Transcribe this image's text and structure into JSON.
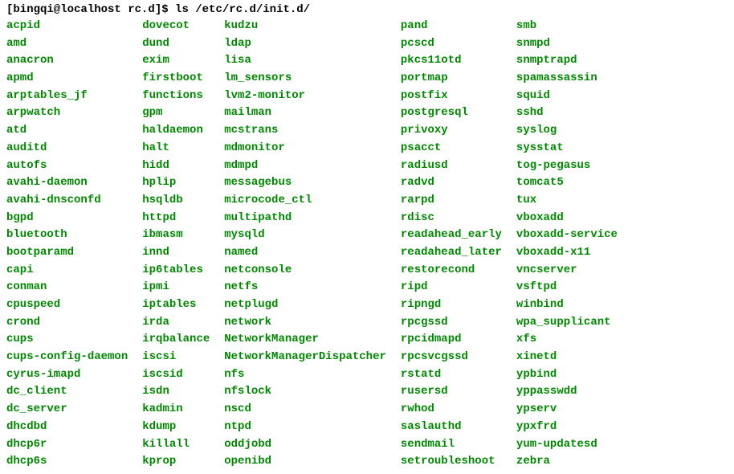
{
  "prompt": "[bingqi@localhost rc.d]$ ",
  "command": "ls /etc/rc.d/init.d/",
  "columns": [
    [
      "acpid",
      "amd",
      "anacron",
      "apmd",
      "arptables_jf",
      "arpwatch",
      "atd",
      "auditd",
      "autofs",
      "avahi-daemon",
      "avahi-dnsconfd",
      "bgpd",
      "bluetooth",
      "bootparamd",
      "capi",
      "conman",
      "cpuspeed",
      "crond",
      "cups",
      "cups-config-daemon",
      "cyrus-imapd",
      "dc_client",
      "dc_server",
      "dhcdbd",
      "dhcp6r",
      "dhcp6s"
    ],
    [
      "dovecot",
      "dund",
      "exim",
      "firstboot",
      "functions",
      "gpm",
      "haldaemon",
      "halt",
      "hidd",
      "hplip",
      "hsqldb",
      "httpd",
      "ibmasm",
      "innd",
      "ip6tables",
      "ipmi",
      "iptables",
      "irda",
      "irqbalance",
      "iscsi",
      "iscsid",
      "isdn",
      "kadmin",
      "kdump",
      "killall",
      "kprop"
    ],
    [
      "kudzu",
      "ldap",
      "lisa",
      "lm_sensors",
      "lvm2-monitor",
      "mailman",
      "mcstrans",
      "mdmonitor",
      "mdmpd",
      "messagebus",
      "microcode_ctl",
      "multipathd",
      "mysqld",
      "named",
      "netconsole",
      "netfs",
      "netplugd",
      "network",
      "NetworkManager",
      "NetworkManagerDispatcher",
      "nfs",
      "nfslock",
      "nscd",
      "ntpd",
      "oddjobd",
      "openibd"
    ],
    [
      "pand",
      "pcscd",
      "pkcs11otd",
      "portmap",
      "postfix",
      "postgresql",
      "privoxy",
      "psacct",
      "radiusd",
      "radvd",
      "rarpd",
      "rdisc",
      "readahead_early",
      "readahead_later",
      "restorecond",
      "ripd",
      "ripngd",
      "rpcgssd",
      "rpcidmapd",
      "rpcsvcgssd",
      "rstatd",
      "rusersd",
      "rwhod",
      "saslauthd",
      "sendmail",
      "setroubleshoot"
    ],
    [
      "smb",
      "snmpd",
      "snmptrapd",
      "spamassassin",
      "squid",
      "sshd",
      "syslog",
      "sysstat",
      "tog-pegasus",
      "tomcat5",
      "tux",
      "vboxadd",
      "vboxadd-service",
      "vboxadd-x11",
      "vncserver",
      "vsftpd",
      "winbind",
      "wpa_supplicant",
      "xfs",
      "xinetd",
      "ypbind",
      "yppasswdd",
      "ypserv",
      "ypxfrd",
      "yum-updatesd",
      "zebra"
    ]
  ]
}
